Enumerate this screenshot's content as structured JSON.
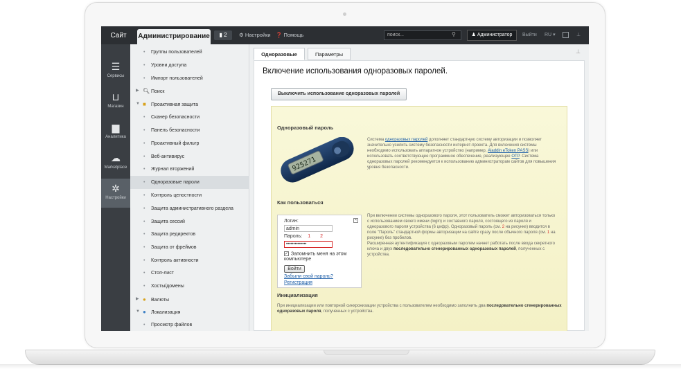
{
  "topbar": {
    "site": "Сайт",
    "admin": "Администрирование",
    "notifications": "2",
    "settings": "Настройки",
    "help": "Помощь",
    "search_placeholder": "поиск...",
    "user": "Администратор",
    "logout": "Выйти",
    "lang": "RU"
  },
  "rail": [
    {
      "label": "Сервисы",
      "icon": "layers-icon"
    },
    {
      "label": "Магазин",
      "icon": "basket-icon"
    },
    {
      "label": "Аналитика",
      "icon": "bar-chart-icon"
    },
    {
      "label": "Marketplace",
      "icon": "cloud-icon"
    },
    {
      "label": "Настройки",
      "icon": "gear-icon"
    }
  ],
  "menu": [
    "Группы пользователей",
    "Уровни доступа",
    "Импорт пользователей",
    "Поиск",
    "Проактивная защита",
    "Сканер безопасности",
    "Панель безопасности",
    "Проактивный фильтр",
    "Веб-антивирус",
    "Журнал вторжений",
    "Одноразовые пароли",
    "Контроль целостности",
    "Защита административного раздела",
    "Защита сессий",
    "Защита редиректов",
    "Защита от фреймов",
    "Контроль активности",
    "Стоп-лист",
    "Хосты/домены",
    "Валюты",
    "Локализация",
    "Просмотр файлов"
  ],
  "tabs": [
    "Одноразовые пароли",
    "Параметры"
  ],
  "page_title": "Включение использования одноразовых паролей.",
  "disable_button": "Выключить использование одноразовых паролей",
  "sections": {
    "otp_title": "Одноразовый пароль",
    "otp_text_1": "Система ",
    "otp_link": "одноразовых паролей",
    "otp_text_2": " дополняет стандартную систему авторизации и позволяет значительно усилить систему безопасности интернет-проекта. Для включения системы необходимо использовать аппаратное устройство (например, ",
    "otp_link_2": "Aladdin eToken PASS",
    "otp_text_3": ") или использовать соответствующее программное обеспечение, реализующее ",
    "otp_link_3": "OTP",
    "otp_text_4": ". Система одноразовых паролей рекомендуется к использованию администраторам сайтов для повышения уровня безопасности.",
    "token_display": "925271",
    "how_title": "Как пользоваться",
    "how_text_1": "При включении системы одноразового пароля, этот пользователь сможет авторизоваться только с использованием своего имени (login) и составного пароля, состоящего из пароля и одноразового пароля устройства (6 цифр). Одноразовый пароль (см. ",
    "how_num_2": "2",
    "how_text_2": " на рисунке) вводится в поле \"Пароль\" стандартной формы авторизации на сайте сразу после обычного пароля (см. ",
    "how_num_1": "1",
    "how_text_3": " на рисунке) без пробелов.",
    "how_text_4": "Расширенная аутентификация с одноразовым паролем начнет работать после ввода секретного ключа и двух ",
    "how_bold": "последовательно сгенерированных одноразовых паролей",
    "how_text_5": ", полученных с устройства.",
    "init_title": "Инициализация",
    "init_text_1": "При инициализации или повторной синхронизации устройства с пользователем необходимо заполнить два ",
    "init_bold": "последовательно сгенерированных одноразовых пароля",
    "init_text_2": ", полученных с устройства."
  },
  "login_form": {
    "login_label": "Логин:",
    "login_value": "admin",
    "password_label": "Пароль:",
    "marker_1": "1",
    "marker_2": "2",
    "password_value": "••••••••••••••",
    "remember": "Запомнить меня на этом компьютере",
    "submit": "Войти",
    "forgot": "Забыли свой пароль?",
    "register": "Регистрация"
  }
}
